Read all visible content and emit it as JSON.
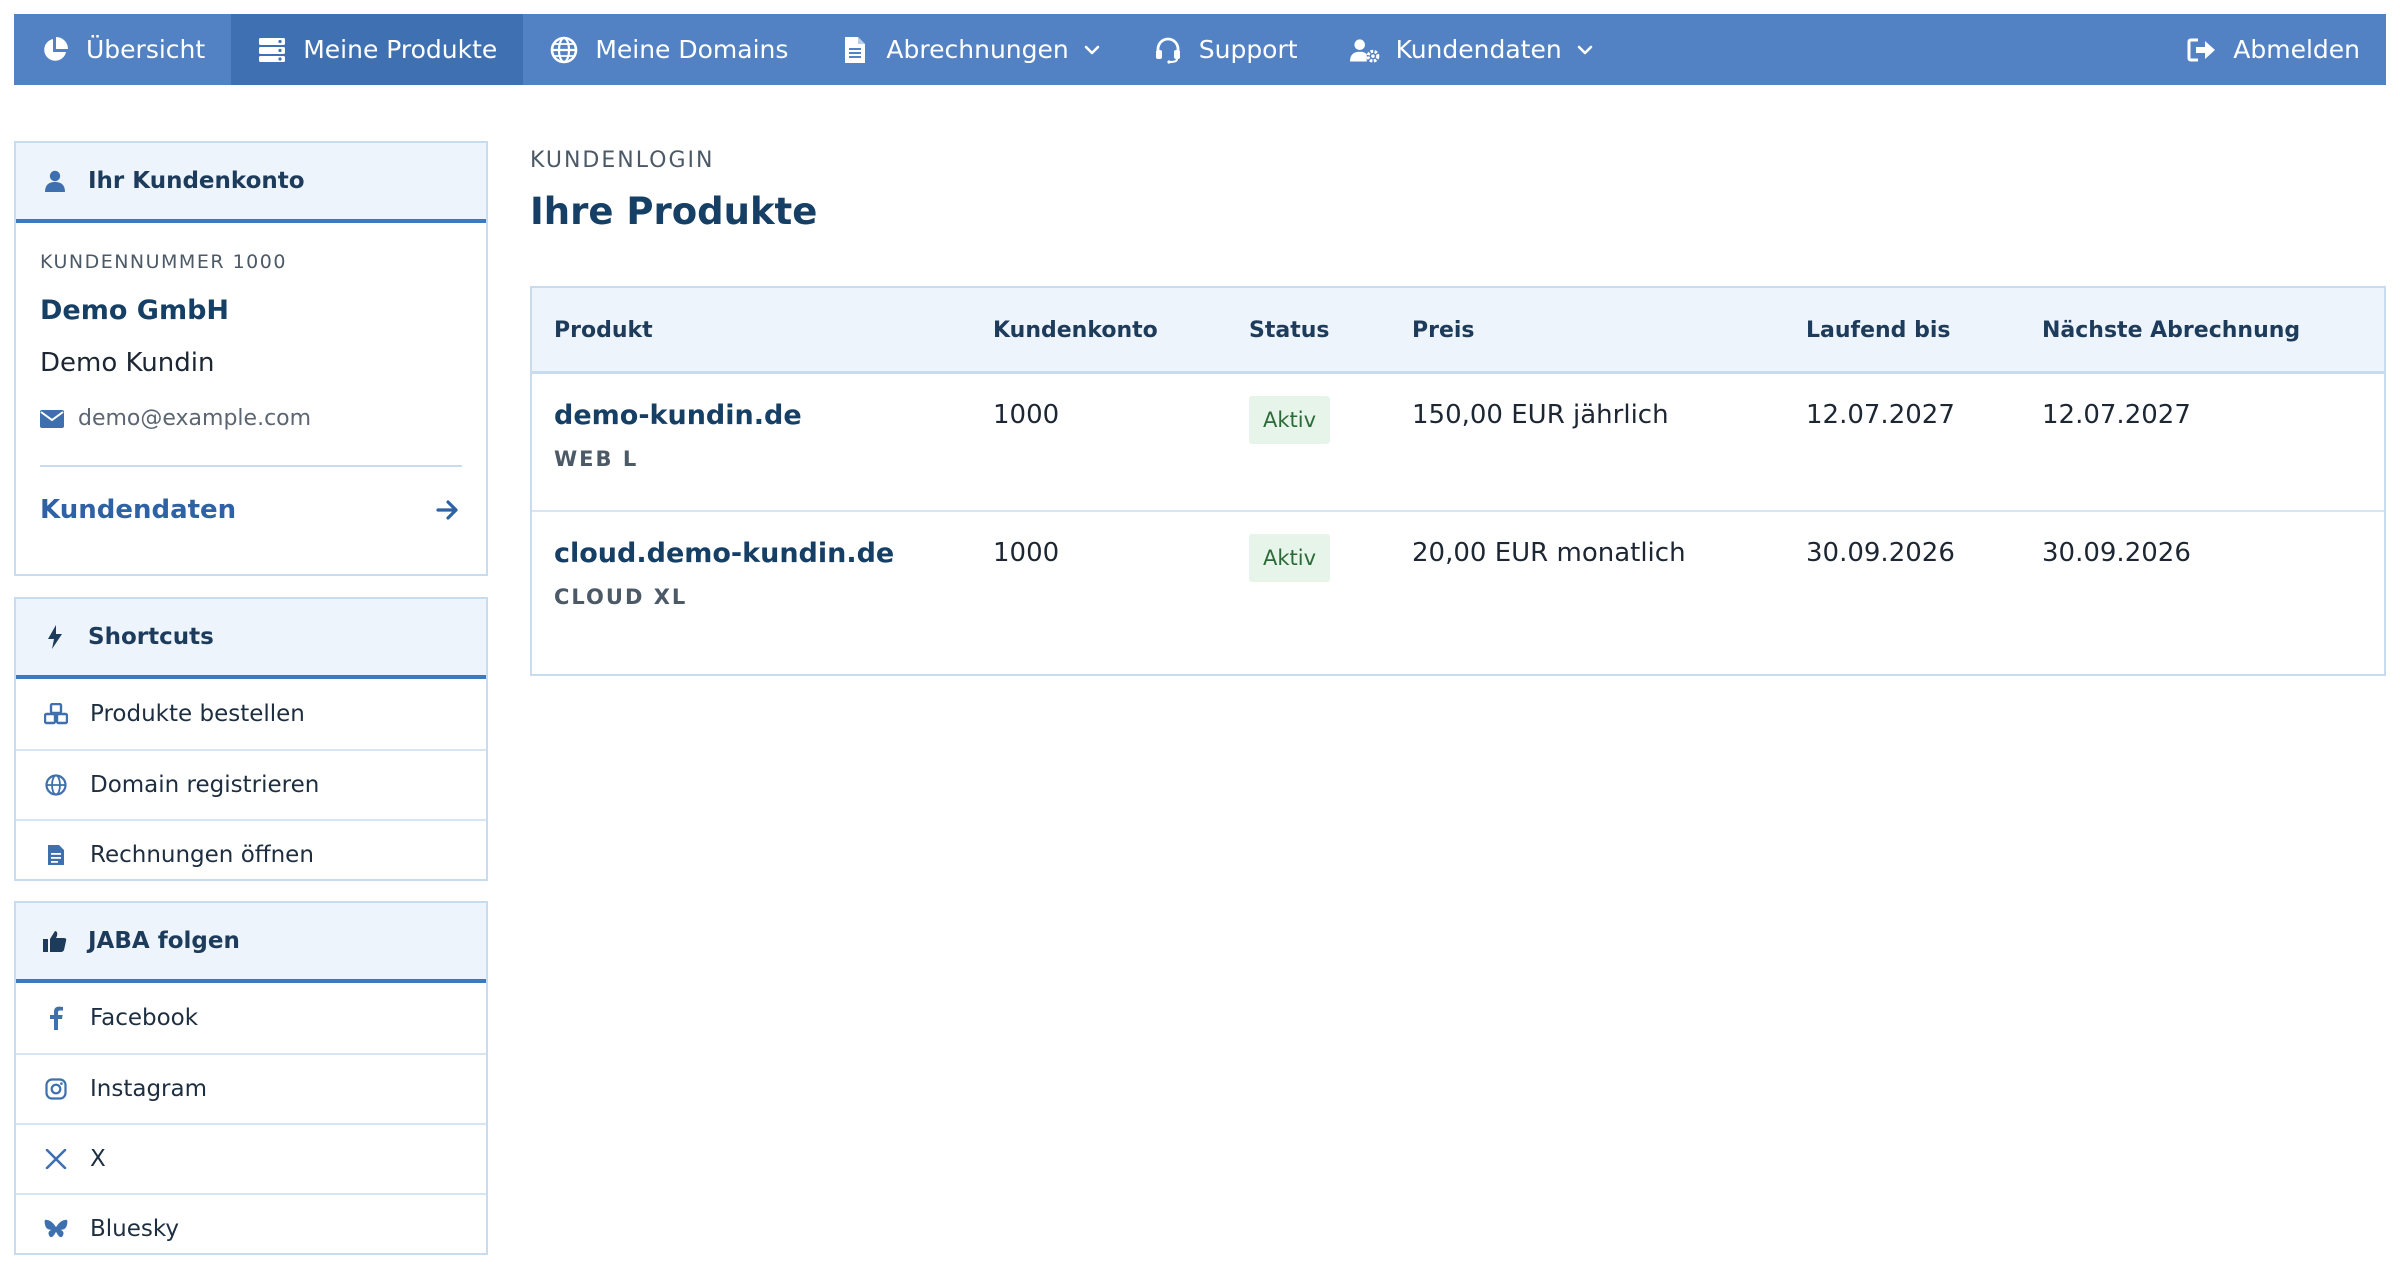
{
  "nav": {
    "items": [
      {
        "label": "Übersicht",
        "icon": "pie-chart-icon"
      },
      {
        "label": "Meine Produkte",
        "icon": "server-icon",
        "active": true
      },
      {
        "label": "Meine Domains",
        "icon": "globe-icon"
      },
      {
        "label": "Abrechnungen",
        "icon": "document-icon",
        "dropdown": true
      },
      {
        "label": "Support",
        "icon": "headset-icon"
      },
      {
        "label": "Kundendaten",
        "icon": "user-gear-icon",
        "dropdown": true
      }
    ],
    "logout": {
      "label": "Abmelden",
      "icon": "logout-icon"
    }
  },
  "account": {
    "title": "Ihr Kundenkonto",
    "customer_number": "KUNDENNUMMER 1000",
    "company": "Demo GmbH",
    "name": "Demo Kundin",
    "email": "demo@example.com",
    "link_label": "Kundendaten"
  },
  "shortcuts": {
    "title": "Shortcuts",
    "items": [
      {
        "label": "Produkte bestellen",
        "icon": "cubes-icon"
      },
      {
        "label": "Domain registrieren",
        "icon": "globe-icon"
      },
      {
        "label": "Rechnungen öffnen",
        "icon": "invoice-icon"
      }
    ]
  },
  "social": {
    "title": "JABA folgen",
    "items": [
      {
        "label": "Facebook",
        "icon": "facebook-icon"
      },
      {
        "label": "Instagram",
        "icon": "instagram-icon"
      },
      {
        "label": "X",
        "icon": "x-icon"
      },
      {
        "label": "Bluesky",
        "icon": "bluesky-icon"
      }
    ]
  },
  "main": {
    "breadcrumb": "KUNDENLOGIN",
    "title": "Ihre Produkte"
  },
  "table": {
    "headers": [
      "Produkt",
      "Kundenkonto",
      "Status",
      "Preis",
      "Laufend bis",
      "Nächste Abrechnung"
    ],
    "rows": [
      {
        "product": "demo-kundin.de",
        "plan": "WEB L",
        "account": "1000",
        "status": "Aktiv",
        "price": "150,00 EUR jährlich",
        "until": "12.07.2027",
        "next_billing": "12.07.2027"
      },
      {
        "product": "cloud.demo-kundin.de",
        "plan": "CLOUD XL",
        "account": "1000",
        "status": "Aktiv",
        "price": "20,00 EUR monatlich",
        "until": "30.09.2026",
        "next_billing": "30.09.2026"
      }
    ]
  },
  "colors": {
    "nav_bg": "#5282c3",
    "nav_active": "#3f71b2",
    "heading": "#163f66",
    "accent": "#3e78bf",
    "status_bg": "#e7f4ea",
    "status_text": "#2d6a3a"
  }
}
